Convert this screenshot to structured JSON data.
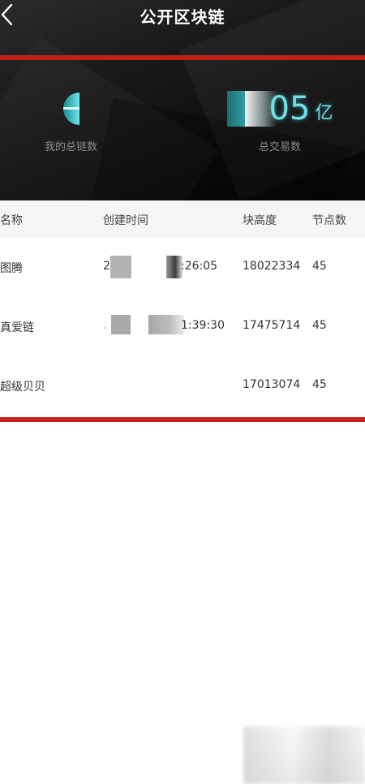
{
  "nav": {
    "title": "公开区块链",
    "back_icon": "chevron-left-icon"
  },
  "stats": {
    "total_chains": {
      "label": "我的总链数"
    },
    "total_transactions": {
      "value_visible": "05",
      "unit": "亿",
      "label": "总交易数"
    }
  },
  "table": {
    "headers": {
      "name": "名称",
      "created_time": "创建时间",
      "block_height": "块高度",
      "nodes": "节点数"
    },
    "rows": [
      {
        "name": "图腾",
        "time_prefix": "2",
        "time_suffix": ":26:05",
        "block_height": "18022334",
        "nodes": "45"
      },
      {
        "name": "真爱链",
        "time_prefix": ".",
        "time_suffix": "1:39:30",
        "block_height": "17475714",
        "nodes": "45"
      },
      {
        "name": "超级贝贝",
        "block_height": "17013074",
        "nodes": "45"
      }
    ]
  },
  "colors": {
    "accent_red": "#c0201c",
    "cyan": "#6ee0ea",
    "header_bg": "#0c0c0c"
  }
}
